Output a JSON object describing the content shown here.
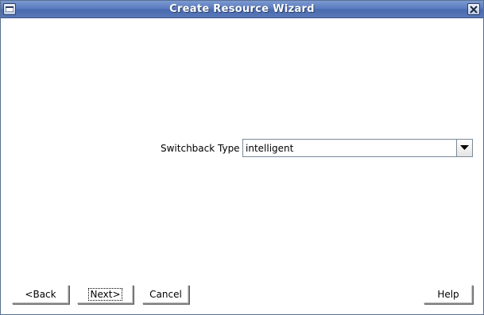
{
  "window": {
    "title": "Create Resource Wizard"
  },
  "form": {
    "field_label": "Switchback Type",
    "field_value": "intelligent"
  },
  "buttons": {
    "back": "<Back",
    "next": "Next>",
    "cancel": "Cancel",
    "help": "Help"
  },
  "icons": {
    "menu": "window-menu-icon",
    "close": "close-icon",
    "dropdown": "chevron-down-icon"
  }
}
